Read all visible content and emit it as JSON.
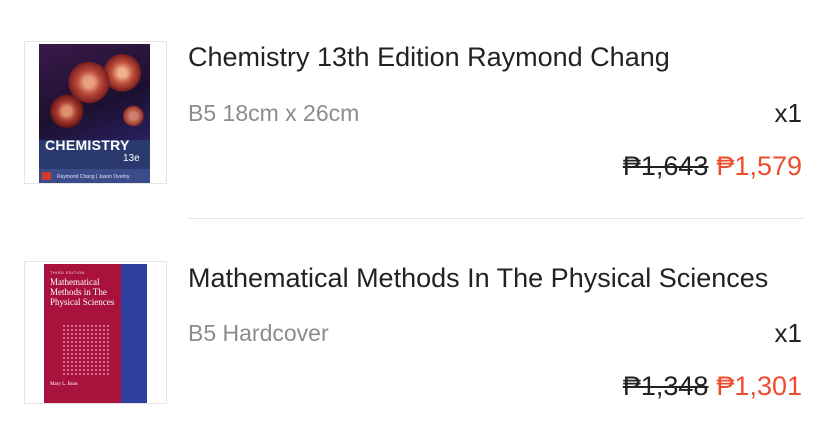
{
  "items": [
    {
      "title": "Chemistry 13th Edition Raymond Chang",
      "variant": "B5 18cm x 26cm",
      "quantity": "x1",
      "original_price": "₱1,643",
      "sale_price": "₱1,579",
      "cover": {
        "title": "CHEMISTRY",
        "edition": "13e",
        "authors": "Raymond Chang  |  Jason Overby"
      }
    },
    {
      "title": "Mathematical Methods In The Physical Sciences",
      "variant": "B5 Hardcover",
      "quantity": "x1",
      "original_price": "₱1,348",
      "sale_price": "₱1,301",
      "cover": {
        "edition": "THIRD EDITION",
        "title": "Mathematical Methods in The Physical Sciences",
        "author": "Mary L. Boas"
      }
    }
  ],
  "colors": {
    "sale_price": "#ee4d2d",
    "variant_text": "#8c8c8c",
    "divider": "#e4e4e4"
  }
}
